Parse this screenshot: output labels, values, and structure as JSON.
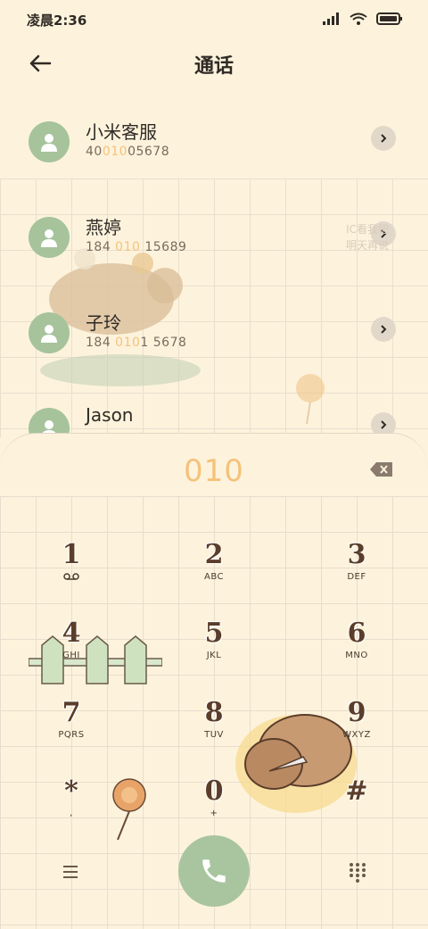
{
  "status": {
    "time": "凌晨2:36"
  },
  "header": {
    "title": "通话"
  },
  "contacts": [
    {
      "name": "小米客服",
      "number_pre": "40",
      "number_hl": "010",
      "number_post": "05678"
    },
    {
      "name": "燕婷",
      "number_pre": "184 ",
      "number_hl": "010",
      "number_post": " 15689"
    },
    {
      "name": "子玲",
      "number_pre": "184 ",
      "number_hl": "010",
      "number_post": "1 5678"
    },
    {
      "name": "Jason",
      "number_pre": "",
      "number_hl": "",
      "number_post": ""
    }
  ],
  "watermark": {
    "line1": "IC看我把",
    "line2": "明天再说"
  },
  "dialpad": {
    "entered": "010",
    "keys": [
      {
        "digit": "1",
        "letters": ""
      },
      {
        "digit": "2",
        "letters": "ABC"
      },
      {
        "digit": "3",
        "letters": "DEF"
      },
      {
        "digit": "4",
        "letters": "GHI"
      },
      {
        "digit": "5",
        "letters": "JKL"
      },
      {
        "digit": "6",
        "letters": "MNO"
      },
      {
        "digit": "7",
        "letters": "PQRS"
      },
      {
        "digit": "8",
        "letters": "TUV"
      },
      {
        "digit": "9",
        "letters": "WXYZ"
      },
      {
        "digit": "*",
        "letters": ","
      },
      {
        "digit": "0",
        "letters": "+"
      },
      {
        "digit": "#",
        "letters": ""
      }
    ]
  },
  "icons": {
    "back": "arrow-left-icon",
    "detail": "chevron-right-icon",
    "backspace": "backspace-icon",
    "voicemail": "voicemail-icon",
    "menu": "menu-icon",
    "call": "phone-icon",
    "keypad": "keypad-icon"
  },
  "colors": {
    "background": "#fdf3dc",
    "accent": "#f5c27a",
    "avatar": "#a6c39c",
    "call": "#a9c59f"
  }
}
